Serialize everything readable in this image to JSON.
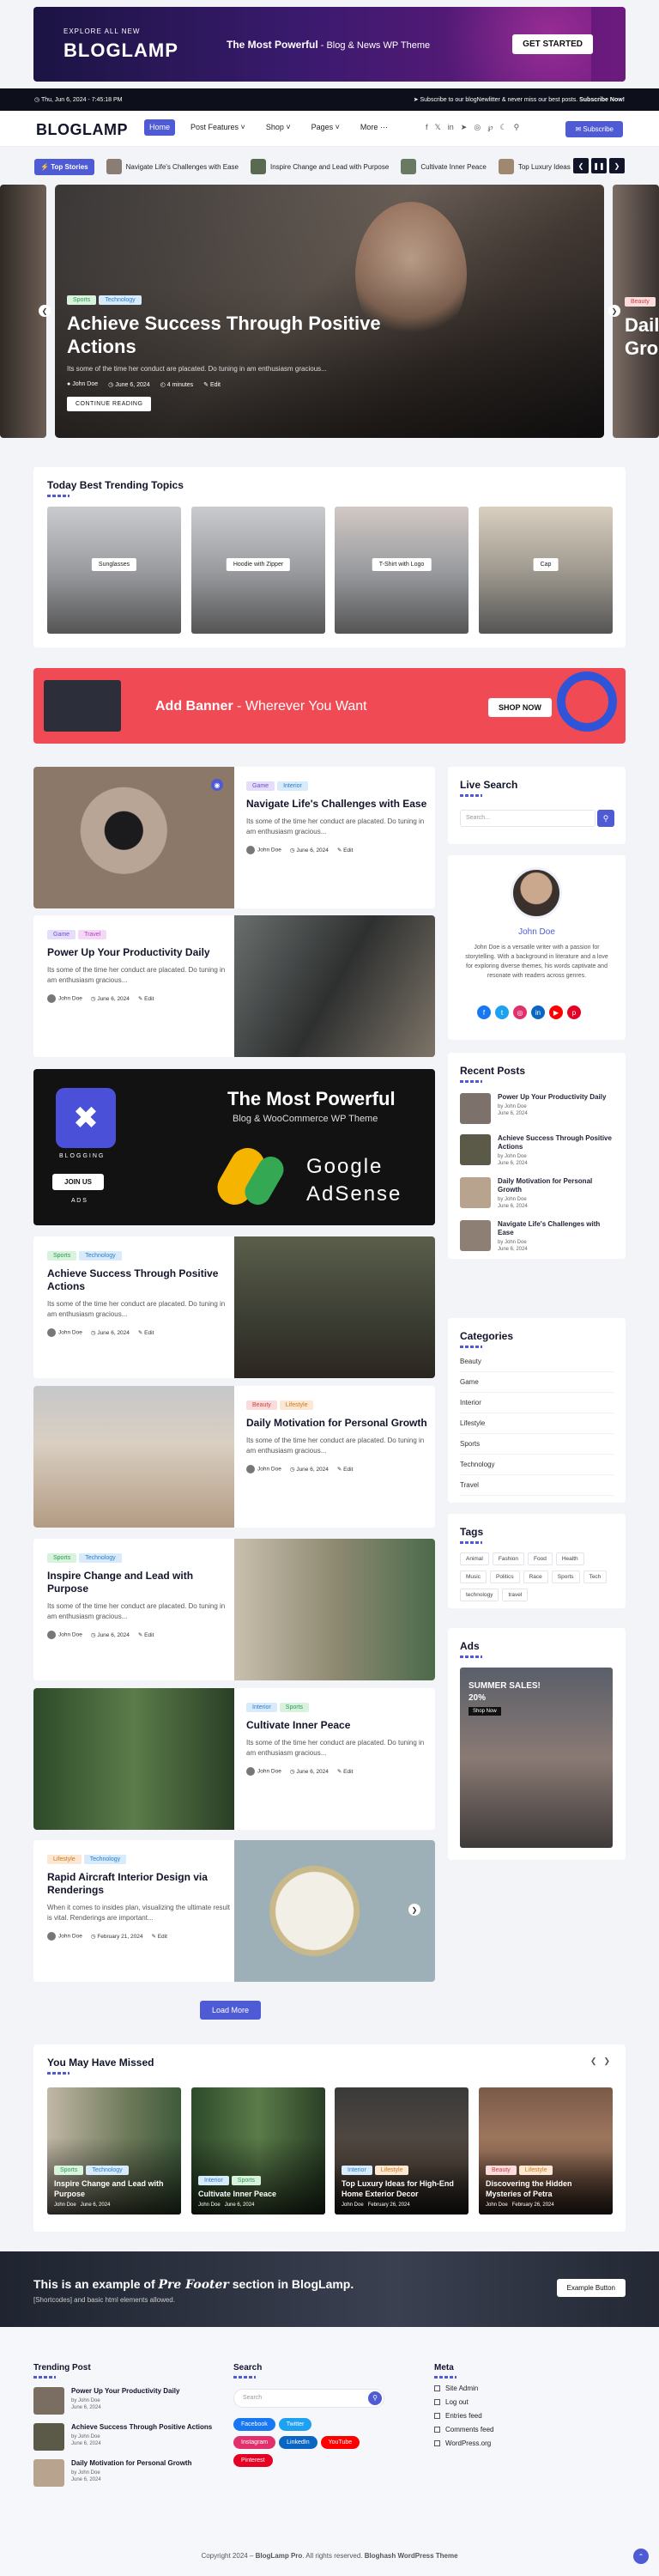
{
  "topbanner": {
    "small": "EXPLORE ALL NEW",
    "logo": "BLOGLAMP",
    "mid_bold": "The Most Powerful",
    "mid_rest": "- Blog & News WP Theme",
    "button": "GET STARTED"
  },
  "topbar": {
    "date": "Thu, Jun 6, 2024 - 7:45:18 PM",
    "subscribe_text": "Subscribe to our blogNewlitter & never miss our best posts.",
    "subscribe_cta": "Subscribe Now!"
  },
  "header": {
    "logo": "BLOGLAMP",
    "nav": [
      "Home",
      "Post Features",
      "Shop",
      "Pages",
      "More"
    ],
    "subscribe": "Subscribe"
  },
  "ticker": {
    "badge": "Top Stories",
    "items": [
      "Navigate Life's Challenges with Ease",
      "Inspire Change and Lead with Purpose",
      "Cultivate Inner Peace",
      "Top Luxury Ideas"
    ]
  },
  "hero": {
    "tags": [
      "Sports",
      "Technology"
    ],
    "title": "Achieve Success Through Positive Actions",
    "excerpt": "Its some of the time her conduct are placated. Do tuning in am enthusiasm gracious...",
    "author": "John Doe",
    "date": "June 6, 2024",
    "read": "4 minutes",
    "edit": "Edit",
    "cta": "CONTINUE READING",
    "right_tag": "Beauty",
    "right_title_1": "Dail",
    "right_title_2": "Gro"
  },
  "trending": {
    "title": "Today Best Trending Topics",
    "items": [
      "Sunglasses",
      "Hoodie with Zipper",
      "T-Shirt with Logo",
      "Cap"
    ]
  },
  "adbanner": {
    "bold": "Add Banner",
    "rest": "- Wherever You Want",
    "button": "SHOP NOW"
  },
  "posts": [
    {
      "tags": [
        "Game",
        "Interior"
      ],
      "title": "Navigate Life's Challenges with Ease",
      "excerpt": "Its some of the time her conduct are placated. Do tuning in am enthusiasm gracious...",
      "author": "John Doe",
      "date": "June 6, 2024",
      "edit": "Edit"
    },
    {
      "tags": [
        "Game",
        "Travel"
      ],
      "title": "Power Up Your Productivity Daily",
      "excerpt": "Its some of the time her conduct are placated. Do tuning in am enthusiasm gracious...",
      "author": "John Doe",
      "date": "June 6, 2024",
      "edit": "Edit"
    },
    {
      "tags": [
        "Sports",
        "Technology"
      ],
      "title": "Achieve Success Through Positive Actions",
      "excerpt": "Its some of the time her conduct are placated. Do tuning in am enthusiasm gracious...",
      "author": "John Doe",
      "date": "June 6, 2024",
      "edit": "Edit"
    },
    {
      "tags": [
        "Beauty",
        "Lifestyle"
      ],
      "title": "Daily Motivation for Personal Growth",
      "excerpt": "Its some of the time her conduct are placated. Do tuning in am enthusiasm gracious...",
      "author": "John Doe",
      "date": "June 6, 2024",
      "edit": "Edit"
    },
    {
      "tags": [
        "Sports",
        "Technology"
      ],
      "title": "Inspire Change and Lead with Purpose",
      "excerpt": "Its some of the time her conduct are placated. Do tuning in am enthusiasm gracious...",
      "author": "John Doe",
      "date": "June 6, 2024",
      "edit": "Edit"
    },
    {
      "tags": [
        "Interior",
        "Sports"
      ],
      "title": "Cultivate Inner Peace",
      "excerpt": "Its some of the time her conduct are placated. Do tuning in am enthusiasm gracious...",
      "author": "John Doe",
      "date": "June 6, 2024",
      "edit": "Edit"
    },
    {
      "tags": [
        "Lifestyle",
        "Technology"
      ],
      "title": "Rapid Aircraft Interior Design via Renderings",
      "excerpt": "When it comes to insides plan, visualizing the ultimate result is vital. Renderings are important...",
      "author": "John Doe",
      "date": "February 21, 2024",
      "edit": "Edit"
    }
  ],
  "admid": {
    "blogging": "BLOGGING",
    "join": "JOIN US",
    "ads": "A D S",
    "line1": "The Most Powerful",
    "line2": "Blog & WooCommerce WP Theme",
    "google": "Google",
    "adsense": "AdSense"
  },
  "sidebar": {
    "search_title": "Live Search",
    "search_placeholder": "Search...",
    "author_name": "John Doe",
    "author_bio": "John Doe is a versatile writer with a passion for storytelling. With a background in literature and a love for exploring diverse themes, his words captivate and resonate with readers across genres.",
    "recent_title": "Recent Posts",
    "recent": [
      {
        "title": "Power Up Your Productivity Daily",
        "by": "by John Doe",
        "date": "June 6, 2024"
      },
      {
        "title": "Achieve Success Through Positive Actions",
        "by": "by John Doe",
        "date": "June 6, 2024"
      },
      {
        "title": "Daily Motivation for Personal Growth",
        "by": "by John Doe",
        "date": "June 6, 2024"
      },
      {
        "title": "Navigate Life's Challenges with Ease",
        "by": "by John Doe",
        "date": "June 6, 2024"
      }
    ],
    "cat_title": "Categories",
    "categories": [
      "Beauty",
      "Game",
      "Interior",
      "Lifestyle",
      "Sports",
      "Technology",
      "Travel"
    ],
    "tags_title": "Tags",
    "tags": [
      "Animal",
      "Fashion",
      "Food",
      "Health",
      "Music",
      "Politics",
      "Race",
      "Sports",
      "Tech",
      "technology",
      "travel"
    ],
    "ads_title": "Ads",
    "ads_sale": "SUMMER SALES!",
    "ads_pct": "20%",
    "ads_btn": "Shop Now"
  },
  "loadmore": "Load More",
  "missed": {
    "title": "You May Have Missed",
    "items": [
      {
        "tags": [
          "Sports",
          "Technology"
        ],
        "title": "Inspire Change and Lead with Purpose",
        "author": "John Doe",
        "date": "June 6, 2024"
      },
      {
        "tags": [
          "Interior",
          "Sports"
        ],
        "title": "Cultivate Inner Peace",
        "author": "John Doe",
        "date": "June 6, 2024"
      },
      {
        "tags": [
          "Interior",
          "Lifestyle"
        ],
        "title": "Top Luxury Ideas for High-End Home Exterior Decor",
        "author": "John Doe",
        "date": "February 26, 2024"
      },
      {
        "tags": [
          "Beauty",
          "Lifestyle"
        ],
        "title": "Discovering the Hidden Mysteries of Petra",
        "author": "John Doe",
        "date": "February 26, 2024"
      }
    ]
  },
  "prefooter": {
    "line_a": "This is an example of",
    "line_em": "Pre Footer",
    "line_b": "section in BlogLamp.",
    "sub": "[Shortcodes] and basic html elements allowed.",
    "button": "Example Button"
  },
  "footer": {
    "trending_title": "Trending Post",
    "trending": [
      {
        "title": "Power Up Your Productivity Daily",
        "by": "by John Doe",
        "date": "June 6, 2024"
      },
      {
        "title": "Achieve Success Through Positive Actions",
        "by": "by John Doe",
        "date": "June 6, 2024"
      },
      {
        "title": "Daily Motivation for Personal Growth",
        "by": "by John Doe",
        "date": "June 6, 2024"
      }
    ],
    "search_title": "Search",
    "search_placeholder": "Search",
    "social": [
      "Facebook",
      "Twitter",
      "Instagram",
      "LinkedIn",
      "YouTube",
      "Pinterest"
    ],
    "meta_title": "Meta",
    "meta": [
      "Site Admin",
      "Log out",
      "Entries feed",
      "Comments feed",
      "WordPress.org"
    ]
  },
  "copyright": {
    "a": "Copyright 2024 –",
    "b": "BlogLamp Pro",
    "c": ". All rights reserved.",
    "d": "Bloghash WordPress Theme"
  },
  "colors": {
    "accent": "#4f5bd5",
    "dark": "#12142a",
    "ad_red": "#f04a55"
  }
}
